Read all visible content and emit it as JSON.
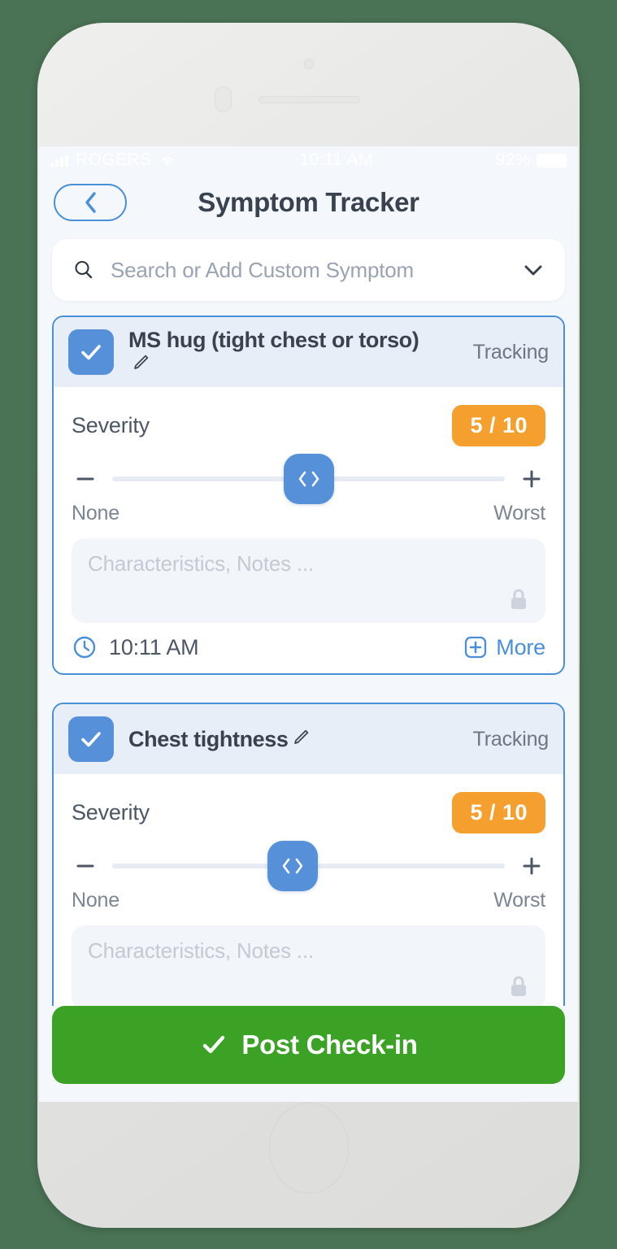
{
  "status_bar": {
    "carrier": "ROGERS",
    "time": "10:11 AM",
    "battery": "92%",
    "signal_icon": "signal-bars-icon",
    "wifi_icon": "wifi-icon",
    "battery_icon": "battery-icon"
  },
  "nav": {
    "title": "Symptom Tracker",
    "back_icon": "chevron-left-icon"
  },
  "search": {
    "placeholder": "Search or Add Custom Symptom",
    "search_icon": "search-icon",
    "chevron_icon": "chevron-down-icon"
  },
  "colors": {
    "accent_blue": "#4a90d9",
    "checkbox_blue": "#5590d9",
    "severity_orange": "#f5a02e",
    "cta_green": "#3ba225",
    "card_header_bg": "#e8eef7",
    "screen_bg": "#f4f7fb",
    "device_bg": "#e6e6e4",
    "page_bg": "#4a7254"
  },
  "cards": [
    {
      "checked": true,
      "name": "MS hug (tight chest or torso)",
      "edit_icon": "pencil-icon",
      "status": "Tracking",
      "severity_label": "Severity",
      "severity_value": "5 / 10",
      "severity_percent": 50,
      "minus_icon": "minus-icon",
      "plus_icon": "plus-icon",
      "thumb_icon": "left-right-chevrons-icon",
      "scale_min": "None",
      "scale_max": "Worst",
      "notes_placeholder": "Characteristics, Notes ...",
      "notes_value": "",
      "lock_icon": "lock-icon",
      "time": "10:11 AM",
      "clock_icon": "clock-icon",
      "more_label": "More",
      "more_icon": "plus-square-icon"
    },
    {
      "checked": true,
      "name": "Chest tightness",
      "edit_icon": "pencil-icon",
      "status": "Tracking",
      "severity_label": "Severity",
      "severity_value": "5 / 10",
      "severity_percent": 46,
      "minus_icon": "minus-icon",
      "plus_icon": "plus-icon",
      "thumb_icon": "left-right-chevrons-icon",
      "scale_min": "None",
      "scale_max": "Worst",
      "notes_placeholder": "Characteristics, Notes ...",
      "notes_value": "",
      "lock_icon": "lock-icon"
    }
  ],
  "cta": {
    "label": "Post Check-in",
    "check_icon": "check-icon"
  }
}
